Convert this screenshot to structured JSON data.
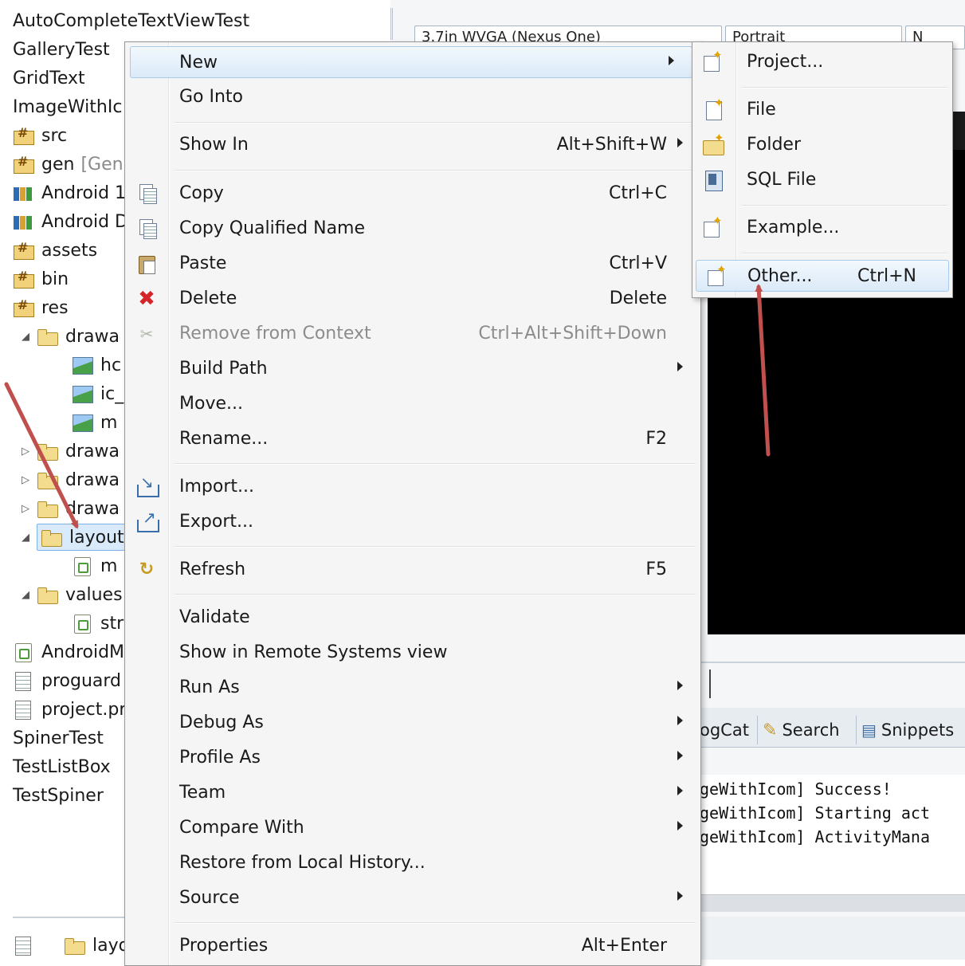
{
  "explorer": {
    "items": [
      {
        "label": "AutoCompleteTextViewTest"
      },
      {
        "label": "GalleryTest"
      },
      {
        "label": "GridText"
      },
      {
        "label": "ImageWithIc"
      },
      {
        "label": "src"
      },
      {
        "label": "gen",
        "suffix": "[Gen"
      },
      {
        "label": "Android 1"
      },
      {
        "label": "Android D"
      },
      {
        "label": "assets"
      },
      {
        "label": "bin"
      },
      {
        "label": "res"
      },
      {
        "label": "drawa"
      },
      {
        "label": "hc"
      },
      {
        "label": "ic_"
      },
      {
        "label": "m"
      },
      {
        "label": "drawa"
      },
      {
        "label": "drawa"
      },
      {
        "label": "drawa"
      },
      {
        "label": "layout"
      },
      {
        "label": "m"
      },
      {
        "label": "values"
      },
      {
        "label": "str"
      },
      {
        "label": "AndroidM"
      },
      {
        "label": "proguard"
      },
      {
        "label": "project.pr"
      },
      {
        "label": "SpinerTest"
      },
      {
        "label": "TestListBox"
      },
      {
        "label": "TestSpiner"
      }
    ],
    "status_label": "layo"
  },
  "editor": {
    "combo1": "3.7in WVGA (Nexus One)",
    "combo2": "Portrait",
    "combo3": "N",
    "bottom_tabs": [
      "ogCat",
      "Search",
      "Snippets"
    ],
    "console_lines": [
      "geWithIcom] Success!",
      "geWithIcom] Starting act",
      "geWithIcom] ActivityMana"
    ]
  },
  "context_menu": {
    "items": [
      {
        "label": "New",
        "shortcut": "",
        "submenu": true
      },
      {
        "label": "Go Into",
        "shortcut": ""
      },
      {
        "label": "Show In",
        "shortcut": "Alt+Shift+W",
        "submenu": true
      },
      {
        "label": "Copy",
        "shortcut": "Ctrl+C",
        "icon": "copy-icon"
      },
      {
        "label": "Copy Qualified Name",
        "shortcut": "",
        "icon": "copy-qualified-name-icon"
      },
      {
        "label": "Paste",
        "shortcut": "Ctrl+V",
        "icon": "paste-icon"
      },
      {
        "label": "Delete",
        "shortcut": "Delete",
        "icon": "delete-icon"
      },
      {
        "label": "Remove from Context",
        "shortcut": "Ctrl+Alt+Shift+Down",
        "disabled": true,
        "icon": "remove-context-icon"
      },
      {
        "label": "Build Path",
        "shortcut": "",
        "submenu": true
      },
      {
        "label": "Move...",
        "shortcut": ""
      },
      {
        "label": "Rename...",
        "shortcut": "F2"
      },
      {
        "label": "Import...",
        "shortcut": "",
        "icon": "import-icon"
      },
      {
        "label": "Export...",
        "shortcut": "",
        "icon": "export-icon"
      },
      {
        "label": "Refresh",
        "shortcut": "F5",
        "icon": "refresh-icon"
      },
      {
        "label": "Validate",
        "shortcut": ""
      },
      {
        "label": "Show in Remote Systems view",
        "shortcut": ""
      },
      {
        "label": "Run As",
        "shortcut": "",
        "submenu": true
      },
      {
        "label": "Debug As",
        "shortcut": "",
        "submenu": true
      },
      {
        "label": "Profile As",
        "shortcut": "",
        "submenu": true
      },
      {
        "label": "Team",
        "shortcut": "",
        "submenu": true
      },
      {
        "label": "Compare With",
        "shortcut": "",
        "submenu": true
      },
      {
        "label": "Restore from Local History...",
        "shortcut": ""
      },
      {
        "label": "Source",
        "shortcut": "",
        "submenu": true
      },
      {
        "label": "Properties",
        "shortcut": "Alt+Enter"
      }
    ]
  },
  "new_submenu": {
    "items": [
      {
        "label": "Project...",
        "shortcut": "",
        "icon": "project-wizard-icon"
      },
      {
        "label": "File",
        "shortcut": "",
        "icon": "new-file-icon"
      },
      {
        "label": "Folder",
        "shortcut": "",
        "icon": "new-folder-icon"
      },
      {
        "label": "SQL File",
        "shortcut": "",
        "icon": "sql-file-icon"
      },
      {
        "label": "Example...",
        "shortcut": "",
        "icon": "example-wizard-icon"
      },
      {
        "label": "Other...",
        "shortcut": "Ctrl+N",
        "icon": "other-wizard-icon"
      }
    ]
  },
  "colors": {
    "highlight": "#dbeaf8",
    "annotation_arrow": "#c0504d",
    "device_screen": "#000000"
  }
}
